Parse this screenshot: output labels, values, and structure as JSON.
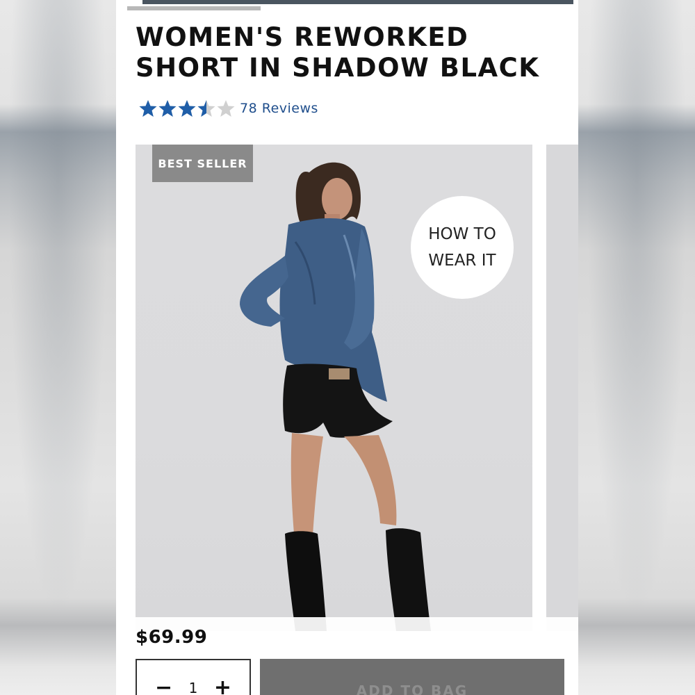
{
  "product": {
    "title_line1": "WOMEN'S REWORKED",
    "title_line2": "SHORT IN SHADOW BLACK",
    "rating_stars": 3.5,
    "rating_max": 5,
    "reviews_label": "78 Reviews",
    "price": "$69.99"
  },
  "gallery": {
    "badge": "BEST SELLER",
    "how_to_line1": "HOW TO",
    "how_to_line2": "WEAR IT"
  },
  "purchase": {
    "qty_minus": "−",
    "qty_value": "1",
    "qty_plus": "+",
    "add_to_bag_label": "ADD TO BAG"
  },
  "colors": {
    "star_filled": "#1f5ea8",
    "star_empty": "#d0d0d0",
    "badge_bg": "#8a8a8a",
    "add_to_bag_bg": "#6f6f6f",
    "link": "#1f4e8c"
  }
}
